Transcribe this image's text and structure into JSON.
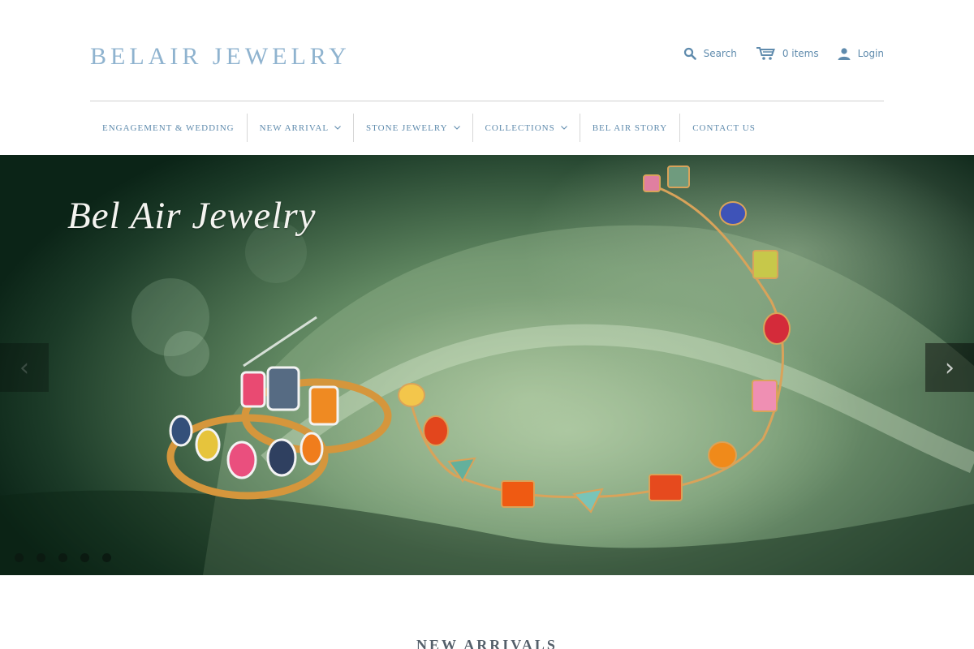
{
  "header": {
    "logo": "BELAIR JEWELRY",
    "search_label": "Search",
    "cart_label": "0 items",
    "login_label": "Login"
  },
  "nav": {
    "items": [
      {
        "label": "ENGAGEMENT & WEDDING",
        "dropdown": false
      },
      {
        "label": "NEW ARRIVAL",
        "dropdown": true
      },
      {
        "label": "STONE JEWELRY",
        "dropdown": true
      },
      {
        "label": "COLLECTIONS",
        "dropdown": true
      },
      {
        "label": "BEL AIR STORY",
        "dropdown": false
      },
      {
        "label": "CONTACT US",
        "dropdown": false
      }
    ]
  },
  "hero": {
    "title": "Bel Air Jewelry",
    "prev_icon": "chevron-left-icon",
    "next_icon": "chevron-right-icon",
    "slide_count": 5,
    "active_slide": 1
  },
  "section": {
    "title": "NEW ARRIVALS"
  },
  "colors": {
    "brand_blue": "#8fb3cf",
    "link_blue": "#5f8bad",
    "satin_green": "#5f8660"
  }
}
